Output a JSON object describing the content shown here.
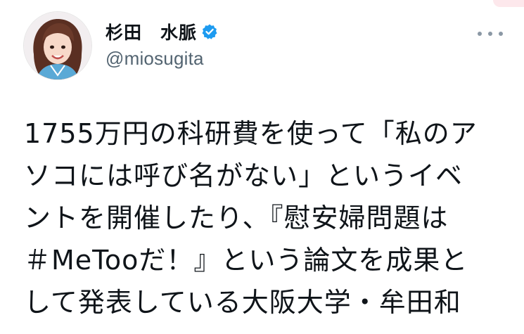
{
  "header": {
    "display_name": "杉田　水脈",
    "handle": "@miosugita",
    "verified": true,
    "verified_icon": "verified-badge-icon",
    "more_icon": "more-options-icon"
  },
  "tweet": {
    "lines": [
      "1755万円の科研費を使って「私のア",
      "ソコには呼び名がない」というイベ",
      "ントを開催したり、『慰安婦問題は",
      "＃MeTooだ！』という論文を成果と",
      "して発表している大阪大学・牟田和"
    ]
  },
  "colors": {
    "text": "#0f1419",
    "secondary": "#536471",
    "verified": "#1d9bf0",
    "corner_tab": "#fde8ec"
  }
}
